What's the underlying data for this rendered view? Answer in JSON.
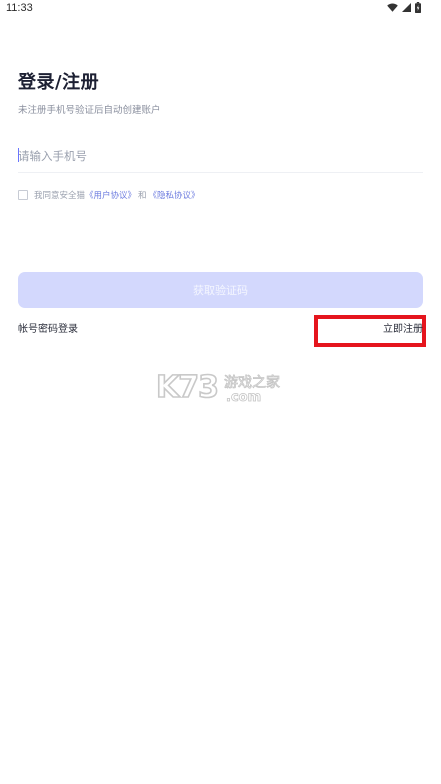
{
  "status_bar": {
    "time": "11:33",
    "icons": [
      "wifi-icon",
      "cellular-signal-icon",
      "battery-icon"
    ]
  },
  "login": {
    "title": "登录/注册",
    "subtitle": "未注册手机号验证后自动创建账户",
    "phone_placeholder": "请输入手机号",
    "phone_value": "",
    "agreement": {
      "prefix": "我同意安全猫",
      "user_agreement": "《用户协议》",
      "conjunction": "和",
      "privacy_policy": "《隐私协议》",
      "checked": false
    },
    "get_code_button": "获取验证码",
    "password_login": "帐号密码登录",
    "register_now": "立即注册"
  },
  "watermark": {
    "brand": "K73",
    "name": "游戏之家",
    "domain": ".com"
  },
  "colors": {
    "button_disabled": "#d3d8fd",
    "link": "#6c7bdf",
    "highlight_box": "#e5151d",
    "text_primary": "#1d2033",
    "text_secondary": "#8a8f9e"
  }
}
